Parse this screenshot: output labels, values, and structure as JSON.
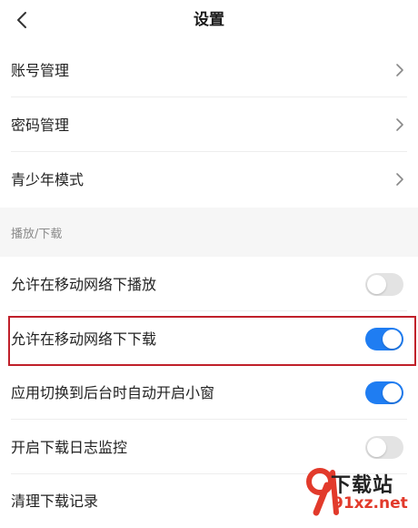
{
  "header": {
    "title": "设置",
    "back_icon": "chevron-left-icon"
  },
  "account_items": [
    {
      "label": "账号管理",
      "icon": "chevron-right-icon"
    },
    {
      "label": "密码管理",
      "icon": "chevron-right-icon"
    },
    {
      "label": "青少年模式",
      "icon": "chevron-right-icon"
    }
  ],
  "playback_section": {
    "title": "播放/下载",
    "items": [
      {
        "label": "允许在移动网络下播放",
        "toggle": "off"
      },
      {
        "label": "允许在移动网络下下载",
        "toggle": "on",
        "highlighted": true
      },
      {
        "label": "应用切换到后台时自动开启小窗",
        "toggle": "on"
      },
      {
        "label": "开启下载日志监控",
        "toggle": "off"
      },
      {
        "label": "清理下载记录"
      }
    ]
  },
  "watermark": {
    "main": "下载站",
    "sub": "91xz.net"
  },
  "colors": {
    "accent": "#1f7df2",
    "toggle_off": "#e3e3e3",
    "highlight": "#c0202a",
    "section_bg": "#f6f6f6"
  }
}
